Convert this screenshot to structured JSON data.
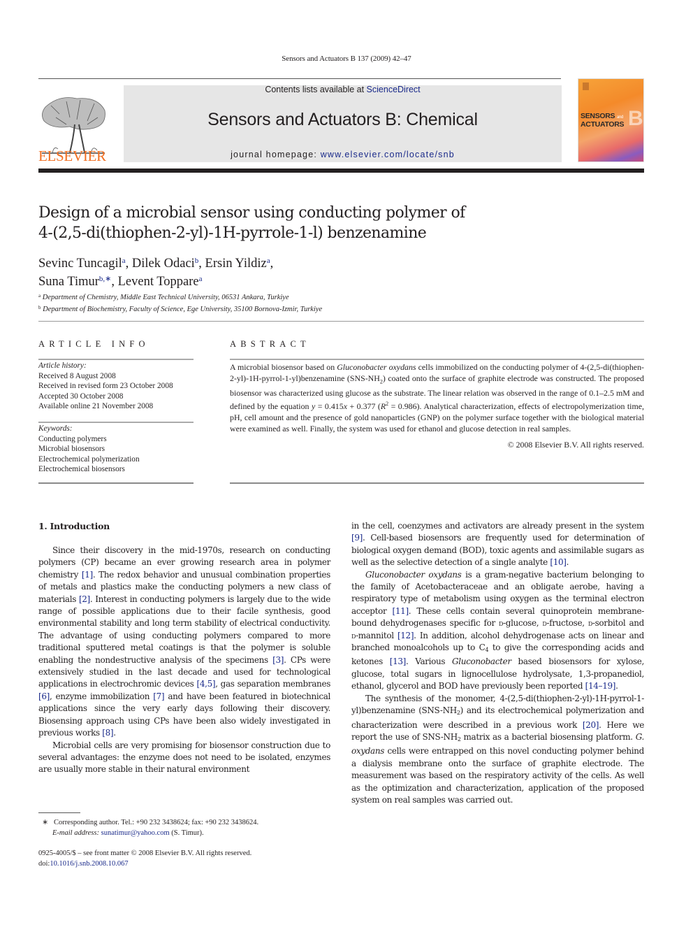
{
  "header": {
    "running_head": "Sensors and Actuators B 137 (2009) 42–47",
    "publisher_logo_text": "ELSEVIER",
    "contents_prefix": "Contents lists available at ",
    "contents_link": "ScienceDirect",
    "journal_title": "Sensors and Actuators B: Chemical",
    "homepage_prefix": "journal homepage: ",
    "homepage_link": "www.elsevier.com/locate/snb",
    "cover": {
      "line1": "SENSORS",
      "line1_small": "and",
      "line2": "ACTUATORS",
      "letter": "B",
      "colors": {
        "top": "#f6a33a",
        "bottom": "#8a5cbf"
      }
    }
  },
  "article": {
    "title_line1": "Design of a microbial sensor using conducting polymer of",
    "title_line2": "4-(2,5-di(thiophen-2-yl)-1H-pyrrole-1-l) benzenamine",
    "authors": [
      {
        "name": "Sevinc Tuncagil",
        "sup": "a",
        "sep": ", "
      },
      {
        "name": "Dilek Odaci",
        "sup": "b",
        "sep": ", "
      },
      {
        "name": "Ersin Yildiz",
        "sup": "a",
        "sep": ","
      },
      {
        "name": "Suna Timur",
        "sup": "b,∗",
        "sep": ", "
      },
      {
        "name": "Levent Toppare",
        "sup": "a",
        "sep": ""
      }
    ],
    "affiliations": [
      {
        "sup": "a",
        "text": "Department of Chemistry, Middle East Technical University, 06531 Ankara, Turkiye"
      },
      {
        "sup": "b",
        "text": "Department of Biochemistry, Faculty of Science, Ege University, 35100 Bornova-Izmir, Turkiye"
      }
    ]
  },
  "article_info": {
    "heading": "ARTICLE INFO",
    "history_label": "Article history:",
    "history": [
      "Received 8 August 2008",
      "Received in revised form 23 October 2008",
      "Accepted 30 October 2008",
      "Available online 21 November 2008"
    ],
    "keywords_label": "Keywords:",
    "keywords": [
      "Conducting polymers",
      "Microbial biosensors",
      "Electrochemical polymerization",
      "Electrochemical biosensors"
    ]
  },
  "abstract": {
    "heading": "ABSTRACT",
    "t1": "A microbial biosensor based on ",
    "organism": "Gluconobacter oxydans",
    "t2": " cells immobilized on the conducting polymer of 4-(2,5-di(thiophen-2-yl)-1H-pyrrol-1-yl)benzenamine (SNS-NH",
    "sub2": "2",
    "t3": ") coated onto the surface of graphite electrode was constructed. The proposed biosensor was characterized using glucose as the substrate. The linear relation was observed in the range of 0.1–2.5 mM and defined by the equation ",
    "eq_y": "y",
    "eq_mid": " = 0.415",
    "eq_x": "x",
    "eq_end": " + 0.377 (",
    "r": "R",
    "r_sup": "2",
    "t4": " = 0.986). Analytical characterization, effects of electropolymerization time, pH, cell amount and the presence of gold nanoparticles (GNP) on the polymer surface together with the biological material were examined as well. Finally, the system was used for ethanol and glucose detection in real samples.",
    "copyright": "© 2008 Elsevier B.V. All rights reserved."
  },
  "intro": {
    "section_title": "1.  Introduction",
    "p1": {
      "a": "Since their discovery in the mid-1970s, research on conducting polymers (CP) became an ever growing research area in polymer chemistry ",
      "r1": "[1]",
      "b": ". The redox behavior and unusual combination properties of metals and plastics make the conducting polymers a new class of materials ",
      "r2": "[2]",
      "c": ". Interest in conducting polymers is largely due to the wide range of possible applications due to their facile synthesis, good environmental stability and long term stability of electrical conductivity. The advantage of using conducting polymers compared to more traditional sputtered metal coatings is that the polymer is soluble enabling the nondestructive analysis of the specimens ",
      "r3": "[3]",
      "d": ". CPs were extensively studied in the last decade and used for technological applications in electrochromic devices ",
      "r4": "[4,5]",
      "e": ", gas separation membranes ",
      "r5": "[6]",
      "f": ", enzyme immobilization ",
      "r6": "[7]",
      "g": " and have been featured in biotechnical applications since the very early days following their discovery. Biosensing approach using CPs have been also widely investigated in previous works ",
      "r7": "[8]",
      "h": "."
    },
    "p2_left": "Microbial cells are very promising for biosensor construction due to several advantages: the enzyme does not need to be isolated, enzymes are usually more stable in their natural environment",
    "p2_right": {
      "a": "in the cell, coenzymes and activators are already present in the system ",
      "r1": "[9]",
      "b": ". Cell-based biosensors are frequently used for determination of biological oxygen demand (BOD), toxic agents and assimilable sugars as well as the selective detection of a single analyte ",
      "r2": "[10]",
      "c": "."
    },
    "p3": {
      "org": "Gluconobacter oxydans",
      "a": " is a gram-negative bacterium belonging to the family of Acetobacteraceae and an obligate aerobe, having a respiratory type of metabolism using oxygen as the terminal electron acceptor ",
      "r1": "[11]",
      "b": ". These cells contain several quinoprotein membrane-bound dehydrogenases specific for ",
      "d1": "d",
      "c": "-glucose, ",
      "d2": "d",
      "e": "-fructose, ",
      "d3": "d",
      "f": "-sorbitol and ",
      "d4": "d",
      "g": "-mannitol ",
      "r2": "[12]",
      "h": ". In addition, alcohol dehydrogenase acts on linear and branched monoalcohols up to C",
      "c4": "4",
      "i": " to give the corresponding acids and ketones ",
      "r3": "[13]",
      "j": ". Various ",
      "org2": "Gluconobacter",
      "k": " based biosensors for xylose, glucose, total sugars in lignocellulose hydrolysate, 1,3-propanediol, ethanol, glycerol and BOD have previously been reported ",
      "r4": "[14–19]",
      "l": "."
    },
    "p4": {
      "a": "The synthesis of the monomer, 4-(2,5-di(thiophen-2-yl)-1H-pyrrol-1-yl)benzenamine (SNS-NH",
      "s1": "2",
      "b": ") and its electrochemical polymerization and characterization were described in a previous work ",
      "r1": "[20]",
      "c": ". Here we report the use of SNS-NH",
      "s2": "2",
      "d": " matrix as a bacterial biosensing platform. ",
      "org": "G. oxydans",
      "e": " cells were entrapped on this novel conducting polymer behind a dialysis membrane onto the surface of graphite electrode. The measurement was based on the respiratory activity of the cells. As well as the optimization and characterization, application of the proposed system on real samples was carried out."
    }
  },
  "footnotes": {
    "star": "∗",
    "corresponding": "Corresponding author. Tel.: +90 232 3438624; fax: +90 232 3438624.",
    "email_label": "E-mail address: ",
    "email": "sunatimur@yahoo.com",
    "email_suffix": " (S. Timur).",
    "issn": "0925-4005/$ – see front matter © 2008 Elsevier B.V. All rights reserved.",
    "doi_label": "doi:",
    "doi": "10.1016/j.snb.2008.10.067"
  },
  "colors": {
    "elsevier_orange": "#f26f21",
    "link_blue": "#1a2a8a",
    "banner_gray": "#e6e6e6"
  }
}
